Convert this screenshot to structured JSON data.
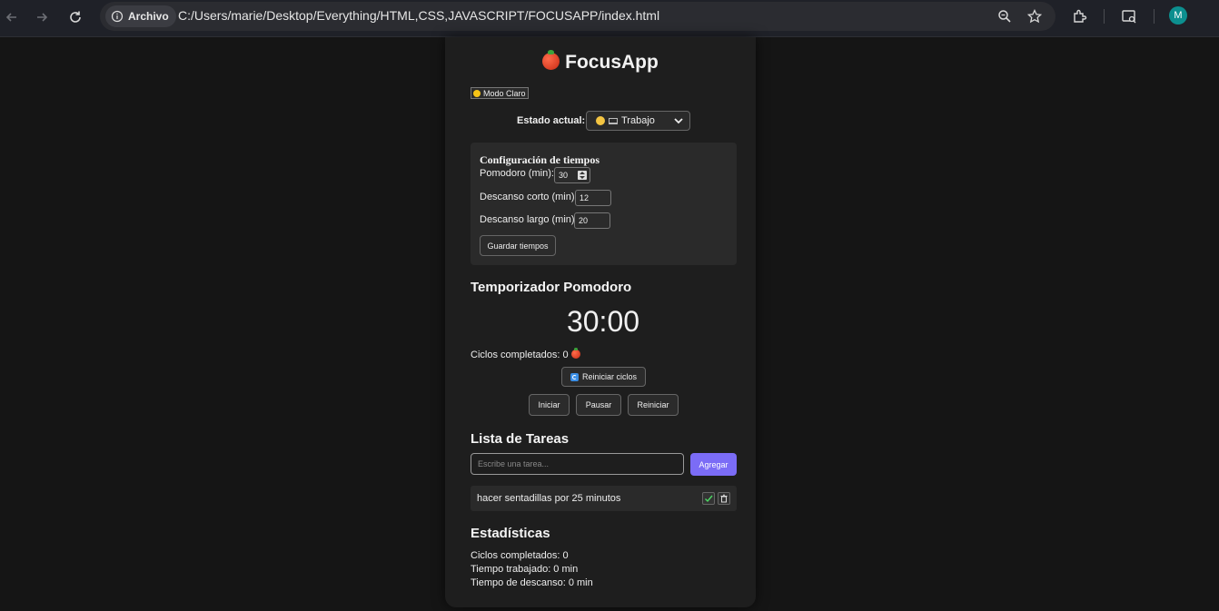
{
  "browser": {
    "security_chip": "Archivo",
    "url": "C:/Users/marie/Desktop/Everything/HTML,CSS,JAVASCRIPT/FOCUSAPP/index.html",
    "profile_initial": "M"
  },
  "app": {
    "title": "FocusApp",
    "mode_button": "Modo Claro",
    "estado_label": "Estado actual:",
    "estado_selected": "Trabajo"
  },
  "config": {
    "title": "Configuración de tiempos",
    "pomodoro_label": "Pomodoro (min):",
    "pomodoro_value": "30",
    "short_label": "Descanso corto (min):",
    "short_value": "12",
    "long_label": "Descanso largo (min):",
    "long_value": "20",
    "save_button": "Guardar tiempos"
  },
  "timer": {
    "heading": "Temporizador Pomodoro",
    "display": "30:00",
    "cycles_text": "Ciclos completados: 0",
    "reset_cycles_button": "Reiniciar ciclos",
    "start_button": "Iniciar",
    "pause_button": "Pausar",
    "reset_button": "Reiniciar"
  },
  "tasks": {
    "heading": "Lista de Tareas",
    "input_placeholder": "Escribe una tarea...",
    "add_button": "Agregar",
    "items": [
      {
        "text": "hacer sentadillas por 25 minutos"
      }
    ]
  },
  "stats": {
    "heading": "Estadísticas",
    "cycles": "Ciclos completados: 0",
    "worked": "Tiempo trabajado: 0 min",
    "rest": "Tiempo de descanso: 0 min"
  },
  "colors": {
    "accent": "#7b6cf6",
    "background": "#151515",
    "card": "#1e1e1e"
  }
}
